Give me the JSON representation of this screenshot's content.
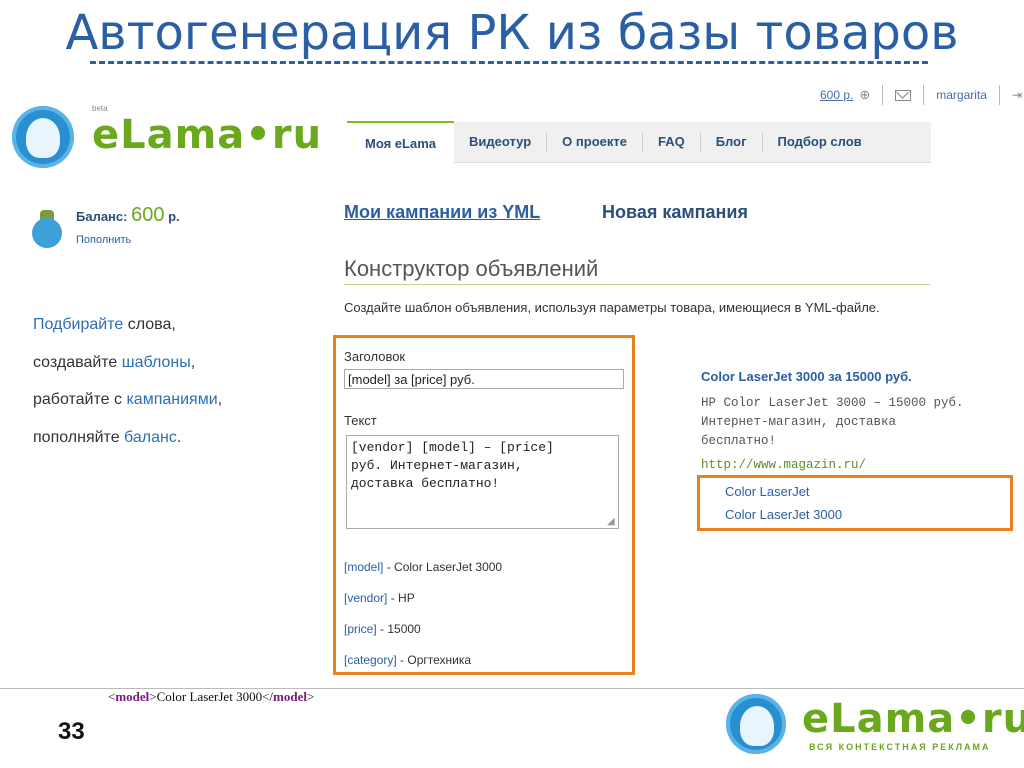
{
  "slide": {
    "title": "Автогенерация РК из базы товаров",
    "page_number": "33"
  },
  "header": {
    "balance_link": "600 р.",
    "username": "margarita"
  },
  "logo": {
    "beta": "beta",
    "text": "eLama•ru",
    "tagline": "ВСЯ КОНТЕКСТНАЯ РЕКЛАМА"
  },
  "tabs": [
    {
      "label": "Моя eLama",
      "active": true
    },
    {
      "label": "Видеотур"
    },
    {
      "label": "О проекте"
    },
    {
      "label": "FAQ"
    },
    {
      "label": "Блог"
    },
    {
      "label": "Подбор слов"
    }
  ],
  "balance": {
    "label": "Баланс:",
    "amount": "600",
    "currency": "р.",
    "topup": "Пополнить"
  },
  "promo": {
    "l1a": "Подбирайте",
    "l1b": " слова,",
    "l2a": "создавайте ",
    "l2b": "шаблоны",
    "l2c": ",",
    "l3a": "работайте с ",
    "l3b": "кампаниями",
    "l3c": ",",
    "l4a": "пополняйте ",
    "l4b": "баланс",
    "l4c": "."
  },
  "main": {
    "campaigns_link": "Мои кампании из YML",
    "new_campaign": "Новая кампания",
    "constructor_title": "Конструктор объявлений",
    "description": "Создайте шаблон объявления, используя параметры товара, имеющиеся в YML-файле."
  },
  "form": {
    "title_label": "Заголовок",
    "title_value": "[model] за [price] руб.",
    "text_label": "Текст",
    "text_value": "[vendor] [model] – [price]\nруб. Интернет-магазин,\nдоставка бесплатно!",
    "params": [
      {
        "key": "[model]",
        "value": " - Color LaserJet 3000"
      },
      {
        "key": "[vendor]",
        "value": " - HP"
      },
      {
        "key": "[price]",
        "value": " - 15000"
      },
      {
        "key": "[category]",
        "value": " - Оргтехника"
      }
    ]
  },
  "preview": {
    "title": "Color LaserJet 3000 за 15000 руб.",
    "text": "HP Color LaserJet 3000 – 15000 руб.\nИнтернет-магазин, доставка\nбесплатно!",
    "url": "http://www.magazin.ru/",
    "sitelinks": [
      "Color LaserJet",
      "Color LaserJet 3000"
    ]
  },
  "xml_line": {
    "open_lt": "<",
    "tag": "model",
    "open_gt": ">",
    "content": "Color LaserJet 3000",
    "close_lt": "</",
    "close_gt": ">"
  }
}
